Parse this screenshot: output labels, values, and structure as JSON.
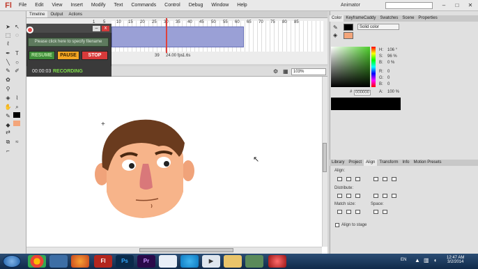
{
  "app": {
    "logo": "Fl",
    "workspace": "Animator"
  },
  "menu": [
    "File",
    "Edit",
    "View",
    "Insert",
    "Modify",
    "Text",
    "Commands",
    "Control",
    "Debug",
    "Window",
    "Help"
  ],
  "window_controls": {
    "minimize": "–",
    "maximize": "□",
    "close": "✕"
  },
  "timeline": {
    "tabs": [
      "Timeline",
      "Output",
      "Actions"
    ],
    "frame_numbers": [
      "1",
      "5",
      "10",
      "15",
      "20",
      "25",
      "30",
      "35",
      "40",
      "45",
      "50",
      "55",
      "60",
      "65",
      "70",
      "75",
      "80",
      "85"
    ],
    "current_frame": "39",
    "fps": "24.00 fps",
    "time": "1.6s"
  },
  "recorder": {
    "filename_hint": "Please click here to specify filename",
    "buttons": {
      "resume": "RESUME",
      "pause": "PAUSE",
      "stop": "STOP"
    },
    "elapsed": "00:00:03",
    "status": "RECORDING",
    "min_label": "–",
    "close_label": "x"
  },
  "stage": {
    "zoom": "103%"
  },
  "color_panel": {
    "tabs": [
      "Color",
      "KeyframeCaddy",
      "Swatches",
      "Scene",
      "Properties"
    ],
    "type": "Solid color",
    "h_label": "H:",
    "h_value": "106 °",
    "s_label": "S:",
    "s_value": "96 %",
    "b_label": "B:",
    "b_value": "0 %",
    "r_label": "R:",
    "r_value": "0",
    "g_label": "G:",
    "g_value": "0",
    "bl_label": "B:",
    "bl_value": "0",
    "a_label": "A:",
    "a_value": "100 %",
    "hex_label": "#",
    "hex_value": "000000"
  },
  "align_panel": {
    "tabs": [
      "Library",
      "Project",
      "Align",
      "Transform",
      "Info",
      "Motion Presets"
    ],
    "align_label": "Align:",
    "distribute_label": "Distribute:",
    "match_label": "Match size:",
    "space_label": "Space:",
    "stage_label": "Align to stage"
  },
  "taskbar": {
    "apps": [
      "Chrome",
      "Explorer",
      "Firefox",
      "Fl",
      "Ps",
      "Pr",
      "Word",
      "Skype",
      "Media",
      "Folder",
      "Tools",
      "Recorder"
    ],
    "lang": "EN",
    "time": "12:47 AM",
    "date": "3/2/2014"
  },
  "colors": {
    "accent": "#e0413b",
    "recording": "#7fe04a",
    "frames": "#9aa0d6"
  }
}
